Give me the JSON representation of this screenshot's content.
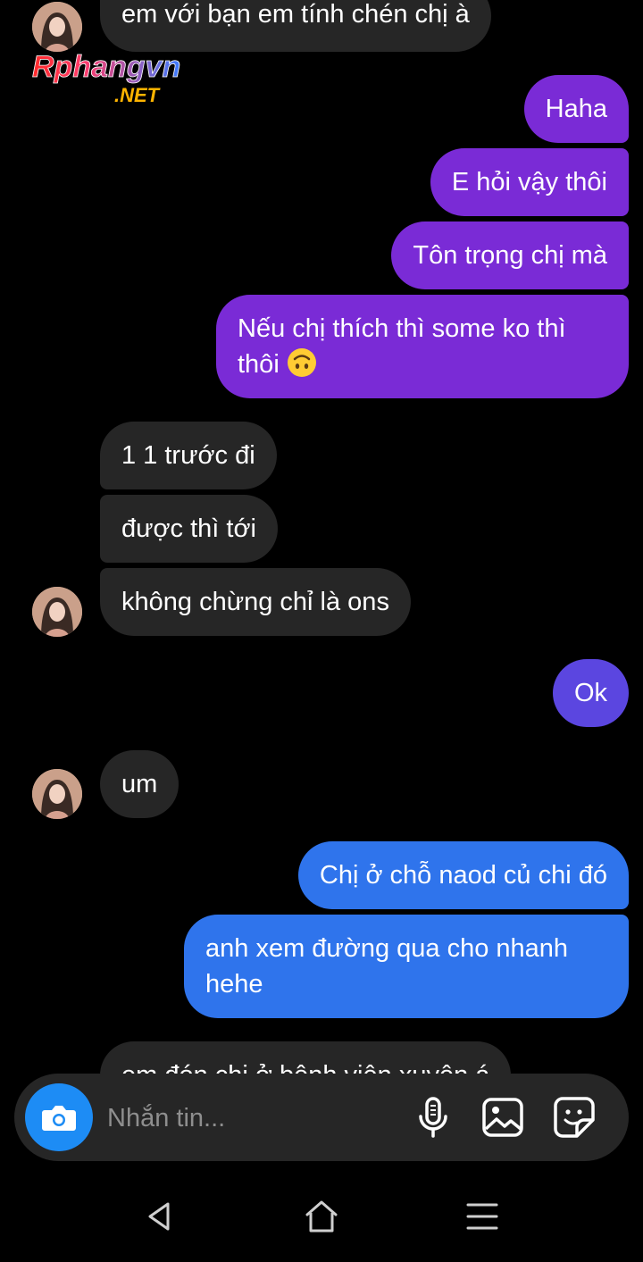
{
  "watermark": {
    "brand": "Rphangvn",
    "domain": ".NET"
  },
  "messages": [
    {
      "text": "em với bạn em tính chén chị à"
    },
    {
      "text": "Haha"
    },
    {
      "text": "E hỏi vậy thôi"
    },
    {
      "text": "Tôn trọng chị mà"
    },
    {
      "text": "Nếu chị thích thì some ko thì thôi"
    },
    {
      "text": "1 1 trước đi"
    },
    {
      "text": "được thì tới"
    },
    {
      "text": "không chừng chỉ là ons"
    },
    {
      "text": "Ok"
    },
    {
      "text": "um"
    },
    {
      "text": "Chị ở chỗ naod củ chi đó"
    },
    {
      "text": "anh xem đường qua cho nhanh hehe"
    },
    {
      "text": "em đón chị ở bệnh viện xuyên á"
    }
  ],
  "composer": {
    "placeholder": "Nhắn tin..."
  },
  "icons": {
    "camera": "camera-icon",
    "mic": "microphone-icon",
    "gallery": "image-icon",
    "sticker": "sticker-icon",
    "back": "back-triangle-icon",
    "home": "home-icon",
    "menu": "menu-icon"
  },
  "colors": {
    "incoming": "#262626",
    "outgoing_purple": "#7a2bd6",
    "outgoing_violet": "#5b46e0",
    "outgoing_blue": "#2f74ec",
    "camera_button": "#1d8cf5"
  }
}
